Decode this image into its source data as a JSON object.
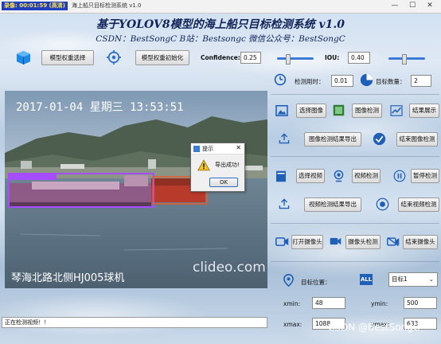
{
  "titlebar": {
    "badge": "录像: 00:01:59 (高清)",
    "title": "海上船只目标检测系统 v1.0",
    "minimize": "—",
    "maximize": "☐",
    "close": "✕"
  },
  "header": {
    "title": "基于YOLOV8模型的海上船只目标检测系统 v1.0",
    "subtitle": "CSDN：BestSongC   B站：Bestsongc   微信公众号：BestSongC"
  },
  "model": {
    "select_label": "模型权重选择",
    "init_label": "模型权重初始化",
    "confidence_label": "Confidence:",
    "confidence_value": "0.25",
    "confidence_level": 0.25,
    "iou_label": "IOU:",
    "iou_value": "0.40",
    "iou_level": 0.4
  },
  "video": {
    "timestamp": "2017-01-04 星期三 13:53:51",
    "caption": "琴海北路北侧HJ005球机",
    "watermark": "clideo.com"
  },
  "dialog": {
    "title": "提示",
    "close": "✕",
    "message": "导出成功!",
    "ok_label": "OK"
  },
  "stats": {
    "time_label": "检测用时：",
    "time_value": "0.01",
    "count_label": "目标数量：",
    "count_value": "2"
  },
  "image_section": {
    "select_label": "选择图像",
    "detect_label": "图像检测",
    "show_label": "结果展示",
    "export_label": "图像检测结果导出",
    "finish_label": "结束图像检测"
  },
  "video_section": {
    "select_label": "选择视频",
    "detect_label": "视频检测",
    "pause_label": "暂停检测",
    "export_label": "视频检测结果导出",
    "finish_label": "结束视频检测"
  },
  "camera_section": {
    "open_label": "打开摄像头",
    "detect_label": "摄像头检测",
    "close_label": "结束摄像头"
  },
  "target": {
    "position_label": "目标位置：",
    "all_badge": "ALL",
    "selected": "目标1",
    "xmin_label": "xmin:",
    "xmin_value": "48",
    "ymin_label": "ymin:",
    "ymin_value": "500",
    "xmax_label": "xmax:",
    "xmax_value": "1088",
    "ymax_label": "ymax:",
    "ymax_value": "633"
  },
  "status": {
    "text": "正在检测视频！！"
  },
  "watermark": "CSDN @BestSongC",
  "colors": {
    "accent": "#3a7bd5",
    "title_text": "#10245a",
    "detection_box": "#a64dff",
    "ship_red": "#c0392b"
  }
}
